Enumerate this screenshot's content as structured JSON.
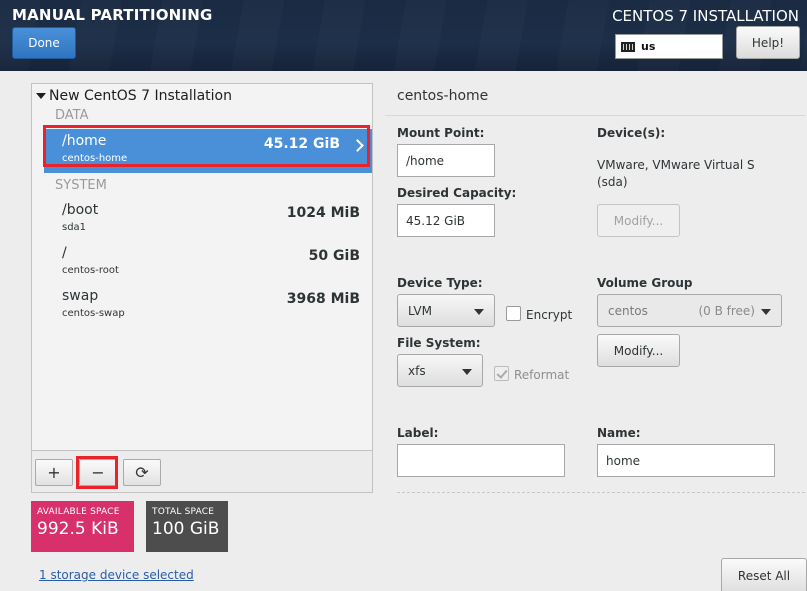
{
  "header": {
    "title": "MANUAL PARTITIONING",
    "done_label": "Done",
    "product_title": "CENTOS 7 INSTALLATION",
    "keyboard_layout": "us",
    "help_label": "Help!"
  },
  "left": {
    "install_title": "New CentOS 7 Installation",
    "groups": {
      "data": "DATA",
      "system": "SYSTEM"
    },
    "mounts": [
      {
        "name": "/home",
        "device": "centos-home",
        "size": "45.12 GiB",
        "selected": true
      },
      {
        "name": "/boot",
        "device": "sda1",
        "size": "1024 MiB",
        "selected": false
      },
      {
        "name": "/",
        "device": "centos-root",
        "size": "50 GiB",
        "selected": false
      },
      {
        "name": "swap",
        "device": "centos-swap",
        "size": "3968 MiB",
        "selected": false
      }
    ],
    "toolbar": {
      "add": "+",
      "remove": "−",
      "refresh": "⟳"
    },
    "available_space": {
      "label": "AVAILABLE SPACE",
      "value": "992.5 KiB",
      "color": "#d8306b"
    },
    "total_space": {
      "label": "TOTAL SPACE",
      "value": "100 GiB",
      "color": "#4d4d4d"
    },
    "storage_link": "1 storage device selected"
  },
  "detail": {
    "title": "centos-home",
    "mount_point_label": "Mount Point:",
    "mount_point_value": "/home",
    "desired_capacity_label": "Desired Capacity:",
    "desired_capacity_value": "45.12 GiB",
    "devices_label": "Device(s):",
    "devices_value_line1": "VMware, VMware Virtual S",
    "devices_value_line2": "(sda)",
    "modify_label": "Modify...",
    "device_type_label": "Device Type:",
    "device_type_value": "LVM",
    "encrypt_label": "Encrypt",
    "volume_group_label": "Volume Group",
    "volume_group_value": "centos",
    "volume_group_free": "(0 B free)",
    "vg_modify_label": "Modify...",
    "file_system_label": "File System:",
    "file_system_value": "xfs",
    "reformat_label": "Reformat",
    "label_label": "Label:",
    "label_value": "",
    "name_label": "Name:",
    "name_value": "home"
  },
  "footer": {
    "reset_label": "Reset All"
  },
  "colors": {
    "accent": "#4a90d9",
    "highlight_frame": "#e8242a"
  }
}
